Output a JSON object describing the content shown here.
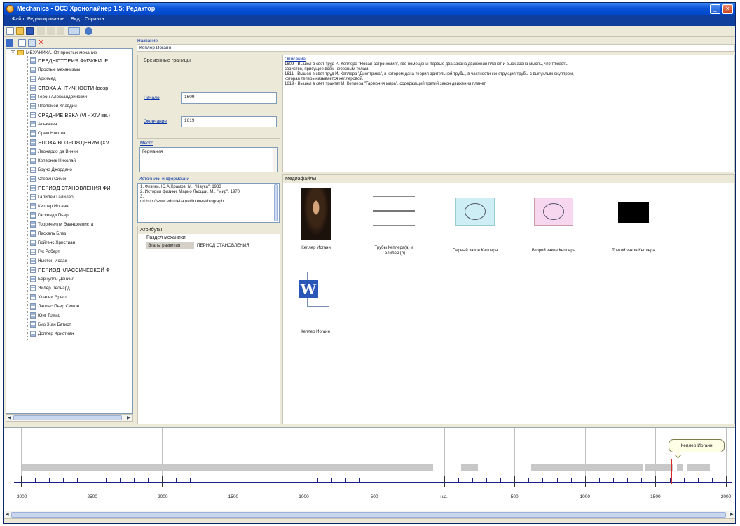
{
  "window": {
    "title": "Mechanics - ОСЗ Хронолайнер 1.5: Редактор",
    "buttons": [
      "minimize",
      "maximize",
      "close"
    ]
  },
  "menu": [
    "Файл",
    "Редактирование",
    "Вид",
    "Справка"
  ],
  "tree": {
    "root": "МЕХАНИКА. От простых механиз",
    "items": [
      {
        "label": "ПРЕДЫСТОРИЯ ФИЗИКИ. Р",
        "era": true
      },
      {
        "label": "Простые механизмы",
        "era": false
      },
      {
        "label": "Архимед",
        "era": false
      },
      {
        "label": "ЭПОХА АНТИЧНОСТИ (возр",
        "era": true
      },
      {
        "label": "Герон Александрийский",
        "era": false
      },
      {
        "label": "Птолемей Клавдий",
        "era": false
      },
      {
        "label": "СРЕДНИЕ ВЕКА (VI - XIV вв.)",
        "era": true
      },
      {
        "label": "Альхазен",
        "era": false
      },
      {
        "label": "Орем Никола",
        "era": false
      },
      {
        "label": "ЭПОХА ВОЗРОЖДЕНИЯ (XV",
        "era": true
      },
      {
        "label": "Леонардо да Винчи",
        "era": false
      },
      {
        "label": "Коперник Николай",
        "era": false
      },
      {
        "label": "Бруно Джордано",
        "era": false
      },
      {
        "label": "Стевин Симон",
        "era": false
      },
      {
        "label": "ПЕРИОД СТАНОВЛЕНИЯ ФИ",
        "era": true
      },
      {
        "label": "Галилей Галилео",
        "era": false
      },
      {
        "label": "Кеплер Иоганн",
        "era": false
      },
      {
        "label": "Гассенди Пьер",
        "era": false
      },
      {
        "label": "Торричелли Эванджелиста",
        "era": false
      },
      {
        "label": "Паскаль Блез",
        "era": false
      },
      {
        "label": "Гюйгенс Христиан",
        "era": false
      },
      {
        "label": "Гук Роберт",
        "era": false
      },
      {
        "label": "Ньютон Исаак",
        "era": false
      },
      {
        "label": "ПЕРИОД КЛАССИЧЕСКОЙ Ф",
        "era": true
      },
      {
        "label": "Бернулли Даниил",
        "era": false
      },
      {
        "label": "Эйлер Леонард",
        "era": false
      },
      {
        "label": "Хладни Эрнст",
        "era": false
      },
      {
        "label": "Лаплас Пьер Симон",
        "era": false
      },
      {
        "label": "Юнг Томас",
        "era": false
      },
      {
        "label": "Био Жан Батист",
        "era": false
      },
      {
        "label": "Доплер Христиан",
        "era": false
      }
    ]
  },
  "details": {
    "name_label": "Название",
    "name_value": "Кеплер Иоганн",
    "time_group_label": "Временные границы",
    "start_label": "Начало",
    "start_value": "1609",
    "end_label": "Окончание",
    "end_value": "1619",
    "place_label": "Место",
    "place_value": "Германия",
    "sources_label": "Источники информации",
    "sources_text": [
      "1. Физики. Ю.А.Храмов, М., \"Наука\", 1983",
      "2. История физики. Марио Льоцци, М., \"Мир\", 1970",
      "3.",
      "url:http://www.edu.delfa.net/Interest/biograph"
    ],
    "attributes_label": "Атрибуты",
    "attr_section": "Раздел механики",
    "attr_key": "Этапы развития",
    "attr_value": "ПЕРИОД СТАНОВЛЕНИЯ",
    "description_label": "Описание",
    "description_lines": [
      "1609 - Вышел в свет труд И. Кеплера \"Новая астрономия\", где помещены первые два закона движения планет и выск азана мысль, что тяжесть -",
      "свойство, присущее всем небесным телам.",
      "1611 - Вышел в свет труд И. Кеплера \"Диоптрика\", в котором дана теория зрительной трубы, в частности конструкция трубы с выпуклым окуляром,",
      "которая теперь называется кеплеровой.",
      "1619 - Вышел в свет трактат И. Кеплера \"Гармония мира\", содержащий третий закон движения планет."
    ],
    "media_label": "Медиафайлы",
    "media": [
      {
        "caption": "Кеплер Иоганн",
        "kind": "portrait"
      },
      {
        "caption": "Трубы Кеплера(а) и Галилея (б)",
        "kind": "diagram"
      },
      {
        "caption": "Первый закон Кеплера",
        "kind": "orbit-blue"
      },
      {
        "caption": "Второй закон Кеплера",
        "kind": "orbit-pink"
      },
      {
        "caption": "Третий закон Кеплера",
        "kind": "black"
      },
      {
        "caption": "Кеплер Иоганн",
        "kind": "word-doc"
      }
    ]
  },
  "timeline": {
    "labels": [
      "-3000",
      "-2500",
      "-2000",
      "-1500",
      "-1000",
      "-500",
      "н.э.",
      "500",
      "1000",
      "1500",
      "2000"
    ],
    "callout": "Кеплер Иоганн",
    "marker_year": 1609,
    "colors": {
      "axis": "#1b1f8a",
      "marker": "#d72a2a",
      "bar": "#c8c8c8"
    }
  }
}
